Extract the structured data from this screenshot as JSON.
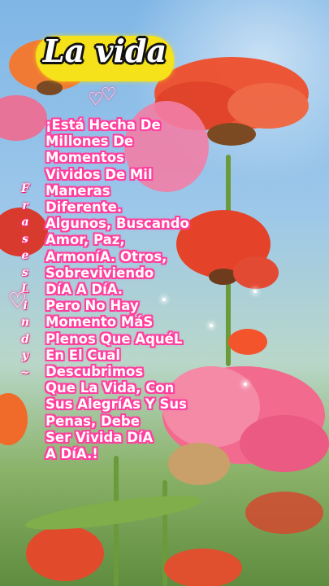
{
  "title": "La vida",
  "poem_lines": [
    "¡Está Hecha De",
    "Millones De",
    "Momentos",
    "Vividos De Mil",
    "Maneras",
    "Diferente.",
    "Algunos, Buscando",
    "Amor, Paz,",
    "ArmoníA. Otros,",
    "Sobreviviendo",
    "DíA A DíA.",
    "Pero No Hay",
    "Momento MáS",
    "Plenos Que AquéL",
    "En El Cual",
    "Descubrimos",
    "Que La Vida, Con",
    "Sus AlegríAs Y Sus",
    "Penas, Debe",
    "Ser Vivida DíA",
    "A DíA.!"
  ],
  "side_letters": [
    "F",
    "r",
    "a",
    "s",
    "e",
    "s",
    "L",
    "i",
    "n",
    "d",
    "y",
    "~"
  ],
  "colors": {
    "text_outline": "#ff3f9e",
    "title_burst": "#f6e21a",
    "petal_red": "#f0502e",
    "petal_pink": "#f27a9a",
    "sky": "#8ebfe8"
  },
  "icons": {
    "hearts": "double-heart-icon",
    "side_heart": "heart-icon"
  }
}
